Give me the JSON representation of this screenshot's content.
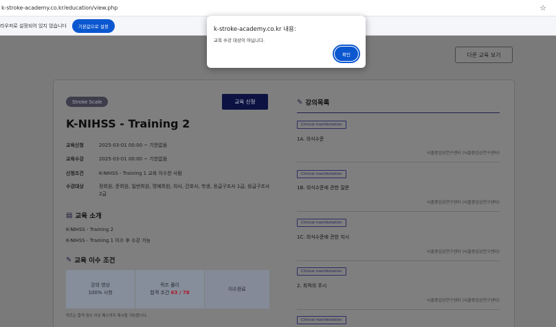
{
  "browser": {
    "url": "k-stroke-academy.co.kr/education/view.php",
    "star_icon": "star-icon"
  },
  "infobar": {
    "message": "라우저로 설정되어 있지 않습니다",
    "button": "기본값으로 설정"
  },
  "dialog": {
    "title": "k-stroke-academy.co.kr 내용:",
    "message": "교육 수강 대상이 아닙니다.",
    "ok": "확인"
  },
  "page": {
    "other_button": "다른 교육 보기",
    "tag": "Stroke Scale",
    "apply_button": "교육 신청",
    "title": "K-NIHSS - Training 2",
    "info": [
      {
        "key": "교육신청",
        "value": "2025-03-01 00:00 ~ 기한없음"
      },
      {
        "key": "교육수강",
        "value": "2025-03-01 00:00 ~ 기한없음"
      },
      {
        "key": "신청조건",
        "value": "K-NIHSS - Training 1 교육 이수한 사람"
      },
      {
        "key": "수강대상",
        "value": "정회원, 준회원, 일반회원, 명예회원, 의사, 간호사, 학생, 응급구조사 1급, 응급구조사 2급"
      }
    ],
    "intro_heading": "교육 소개",
    "intro_lines": [
      "K-NIHSS - Training 2",
      "K-NIHSS - Training 1 이수 후 수강 가능"
    ],
    "condition_heading": "교육 이수 조건",
    "conditions": {
      "video_label": "강의 영상",
      "video_value": "100% 시청",
      "quiz_label": "퀴즈 풀이",
      "quiz_prefix": "합격 조건",
      "quiz_score": "63 / 78",
      "done": "이수완료"
    },
    "note": "퀴즈는 합격 점수 이상 패스까지 재시험 가능합니다."
  },
  "lectures": {
    "heading": "강의목록",
    "items": [
      {
        "tag": "Clinical manifestation",
        "title": "1A. 의식수준",
        "source": "뇌졸중임상연구센터 (뇌졸중임상연구센터)"
      },
      {
        "tag": "Clinical manifestation",
        "title": "1B. 의식수준에 관한 질문",
        "source": "뇌졸중임상연구센터 (뇌졸중임상연구센터)"
      },
      {
        "tag": "Clinical manifestation",
        "title": "1C. 의식수준에 관한 지시",
        "source": "뇌졸중임상연구센터 (뇌졸중임상연구센터)"
      },
      {
        "tag": "Clinical manifestation",
        "title": "2. 최적의 주시",
        "source": "뇌졸중임상연구센터 (뇌졸중임상연구센터)"
      },
      {
        "tag": "Clinical manifestation"
      }
    ]
  }
}
